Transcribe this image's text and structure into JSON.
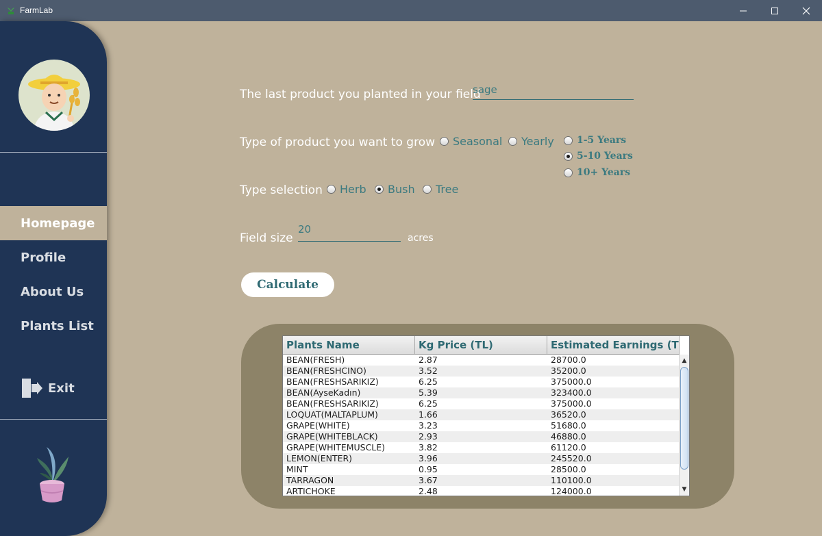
{
  "window": {
    "title": "FarmLab"
  },
  "sidebar": {
    "items": [
      {
        "label": "Homepage",
        "active": true
      },
      {
        "label": "Profile",
        "active": false
      },
      {
        "label": "About Us",
        "active": false
      },
      {
        "label": "Plants List",
        "active": false
      }
    ],
    "exit_label": "Exit",
    "avatar_icon": "farmer-avatar-icon",
    "plant_icon": "potted-plant-icon"
  },
  "form": {
    "last_product_label": "The last product you planted in your field",
    "last_product_value": "sage",
    "product_type_label": "Type of product you want to grow",
    "product_types": [
      "Seasonal",
      "Yearly"
    ],
    "durations": [
      {
        "label": "1-5 Years",
        "checked": false
      },
      {
        "label": "5-10 Years",
        "checked": true
      },
      {
        "label": "10+ Years",
        "checked": false
      }
    ],
    "type_selection_label": "Type selection",
    "type_options": [
      {
        "label": "Herb",
        "checked": false
      },
      {
        "label": "Bush",
        "checked": true
      },
      {
        "label": "Tree",
        "checked": false
      }
    ],
    "field_size_label": "Field size",
    "field_size_value": "20",
    "field_size_unit": "acres",
    "calculate_label": "Calculate"
  },
  "table": {
    "columns": [
      "Plants Name",
      "Kg Price (TL)",
      "Estimated Earnings (TL)"
    ],
    "rows": [
      [
        "BEAN(FRESH)",
        "2.87",
        "28700.0"
      ],
      [
        "BEAN(FRESHCINO)",
        "3.52",
        "35200.0"
      ],
      [
        "BEAN(FRESHSARIKIZ)",
        "6.25",
        "375000.0"
      ],
      [
        "BEAN(AyseKadın)",
        "5.39",
        "323400.0"
      ],
      [
        "BEAN(FRESHSARIKIZ)",
        "6.25",
        "375000.0"
      ],
      [
        "LOQUAT(MALTAPLUM)",
        "1.66",
        "36520.0"
      ],
      [
        "GRAPE(WHITE)",
        "3.23",
        "51680.0"
      ],
      [
        "GRAPE(WHITEBLACK)",
        "2.93",
        "46880.0"
      ],
      [
        "GRAPE(WHITEMUSCLE)",
        "3.82",
        "61120.0"
      ],
      [
        "LEMON(ENTER)",
        "3.96",
        "245520.0"
      ],
      [
        "MINT",
        "0.95",
        "28500.0"
      ],
      [
        "TARRAGON",
        "3.67",
        "110100.0"
      ],
      [
        "ARTICHOKE",
        "2.48",
        "124000.0"
      ]
    ]
  },
  "colors": {
    "background": "#bfb29b",
    "sidebar": "#1f3455",
    "accent": "#2f6a73",
    "table_panel": "#8d8368"
  }
}
